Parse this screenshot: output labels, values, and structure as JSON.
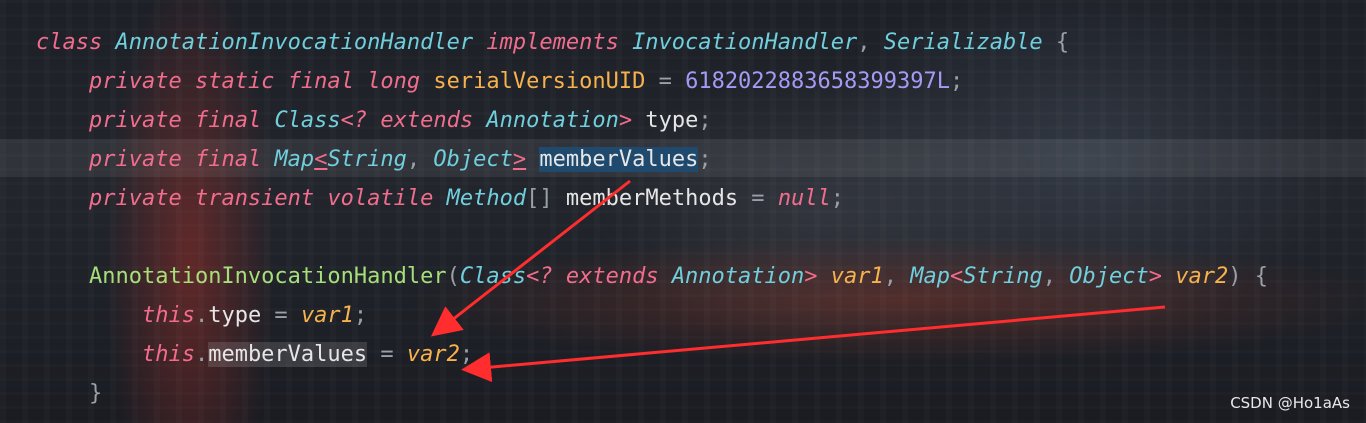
{
  "editor": {
    "lines": [
      [
        {
          "t": "class",
          "c": "kw"
        },
        {
          "t": " "
        },
        {
          "t": "AnnotationInvocationHandler",
          "c": "type"
        },
        {
          "t": " "
        },
        {
          "t": "implements",
          "c": "kw"
        },
        {
          "t": " "
        },
        {
          "t": "InvocationHandler",
          "c": "type"
        },
        {
          "t": ", ",
          "c": "punc"
        },
        {
          "t": "Serializable",
          "c": "type"
        },
        {
          "t": " {",
          "c": "punc"
        }
      ],
      [
        {
          "t": "    "
        },
        {
          "t": "private",
          "c": "kw"
        },
        {
          "t": " "
        },
        {
          "t": "static",
          "c": "kw"
        },
        {
          "t": " "
        },
        {
          "t": "final",
          "c": "kw"
        },
        {
          "t": " "
        },
        {
          "t": "long",
          "c": "kw"
        },
        {
          "t": " "
        },
        {
          "t": "serialVersionUID",
          "c": "field"
        },
        {
          "t": " = ",
          "c": "punc"
        },
        {
          "t": "6182022883658399397L",
          "c": "num"
        },
        {
          "t": ";",
          "c": "punc"
        }
      ],
      [
        {
          "t": "    "
        },
        {
          "t": "private",
          "c": "kw"
        },
        {
          "t": " "
        },
        {
          "t": "final",
          "c": "kw"
        },
        {
          "t": " "
        },
        {
          "t": "Class",
          "c": "type"
        },
        {
          "t": "<? ",
          "c": "kw"
        },
        {
          "t": "extends",
          "c": "kw"
        },
        {
          "t": " "
        },
        {
          "t": "Annotation",
          "c": "type"
        },
        {
          "t": "> ",
          "c": "kw"
        },
        {
          "t": "type",
          "c": "ident"
        },
        {
          "t": ";",
          "c": "punc"
        }
      ],
      [
        {
          "t": "    "
        },
        {
          "t": "private",
          "c": "kw"
        },
        {
          "t": " "
        },
        {
          "t": "final",
          "c": "kw"
        },
        {
          "t": " "
        },
        {
          "t": "Map",
          "c": "type"
        },
        {
          "t": "<",
          "c": "kw ul"
        },
        {
          "t": "String",
          "c": "type"
        },
        {
          "t": ", ",
          "c": "punc"
        },
        {
          "t": "Object",
          "c": "type"
        },
        {
          "t": ">",
          "c": "kw ul"
        },
        {
          "t": " "
        },
        {
          "t": "memberValues",
          "c": "ident sel"
        },
        {
          "t": ";",
          "c": "punc"
        }
      ],
      [
        {
          "t": "    "
        },
        {
          "t": "private",
          "c": "kw"
        },
        {
          "t": " "
        },
        {
          "t": "transient",
          "c": "kw"
        },
        {
          "t": " "
        },
        {
          "t": "volatile",
          "c": "kw"
        },
        {
          "t": " "
        },
        {
          "t": "Method",
          "c": "type"
        },
        {
          "t": "[]",
          "c": "punc"
        },
        {
          "t": " "
        },
        {
          "t": "memberMethods",
          "c": "ident"
        },
        {
          "t": " = ",
          "c": "punc"
        },
        {
          "t": "null",
          "c": "kw"
        },
        {
          "t": ";",
          "c": "punc"
        }
      ],
      [],
      [
        {
          "t": "    "
        },
        {
          "t": "AnnotationInvocationHandler",
          "c": "func"
        },
        {
          "t": "(",
          "c": "punc"
        },
        {
          "t": "Class",
          "c": "type"
        },
        {
          "t": "<? ",
          "c": "kw"
        },
        {
          "t": "extends",
          "c": "kw"
        },
        {
          "t": " "
        },
        {
          "t": "Annotation",
          "c": "type"
        },
        {
          "t": "> ",
          "c": "kw"
        },
        {
          "t": "var1",
          "c": "param"
        },
        {
          "t": ", ",
          "c": "punc"
        },
        {
          "t": "Map",
          "c": "type"
        },
        {
          "t": "<",
          "c": "kw"
        },
        {
          "t": "String",
          "c": "type"
        },
        {
          "t": ", ",
          "c": "punc"
        },
        {
          "t": "Object",
          "c": "type"
        },
        {
          "t": "> ",
          "c": "kw"
        },
        {
          "t": "var2",
          "c": "param"
        },
        {
          "t": ") {",
          "c": "punc"
        }
      ],
      [
        {
          "t": "        "
        },
        {
          "t": "this",
          "c": "kw"
        },
        {
          "t": ".",
          "c": "punc"
        },
        {
          "t": "type",
          "c": "ident"
        },
        {
          "t": " = ",
          "c": "punc"
        },
        {
          "t": "var1",
          "c": "param"
        },
        {
          "t": ";",
          "c": "punc"
        }
      ],
      [
        {
          "t": "        "
        },
        {
          "t": "this",
          "c": "kw"
        },
        {
          "t": ".",
          "c": "punc"
        },
        {
          "t": "memberValues",
          "c": "ident hl"
        },
        {
          "t": " = ",
          "c": "punc"
        },
        {
          "t": "var2",
          "c": "param"
        },
        {
          "t": ";",
          "c": "punc"
        }
      ],
      [
        {
          "t": "    "
        },
        {
          "t": "}",
          "c": "punc"
        }
      ]
    ]
  },
  "watermark": "CSDN @Ho1aAs",
  "colors": {
    "keyword": "#f26d8d",
    "type": "#6fcfdc",
    "function": "#a6df7a",
    "parameter": "#f7b24d",
    "number": "#a79af5",
    "annotation_arrow": "#ff2d2d"
  }
}
